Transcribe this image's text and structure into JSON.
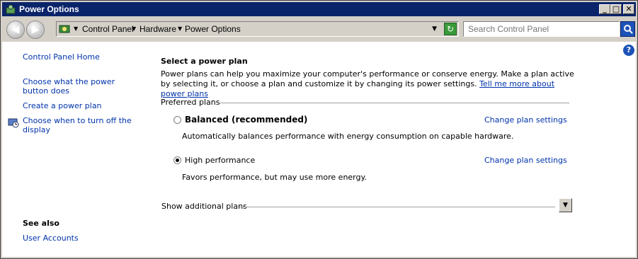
{
  "window": {
    "title": "Power Options"
  },
  "title_buttons": {
    "minimize": "_",
    "maximize": "□",
    "close": "✕"
  },
  "address": {
    "crumbs": [
      "Control Panel",
      "Hardware",
      "Power Options"
    ]
  },
  "search": {
    "placeholder": "Search Control Panel"
  },
  "sidebar": {
    "home": "Control Panel Home",
    "links": [
      {
        "label": "Choose what the power button does"
      },
      {
        "label": "Create a power plan"
      },
      {
        "label": "Choose when to turn off the display"
      }
    ],
    "see_also_title": "See also",
    "see_also_links": [
      {
        "label": "User Accounts"
      }
    ]
  },
  "main": {
    "title": "Select a power plan",
    "intro": "Power plans can help you maximize your computer's performance or conserve energy. Make a plan active by selecting it, or choose a plan and customize it by changing its power settings.",
    "intro_link": "Tell me more about power plans",
    "preferred_label": "Preferred plans",
    "plans": [
      {
        "name": "Balanced (recommended)",
        "description": "Automatically balances performance with energy consumption on capable hardware.",
        "change_link": "Change plan settings",
        "selected": false
      },
      {
        "name": "High performance",
        "description": "Favors performance, but may use more energy.",
        "change_link": "Change plan settings",
        "selected": true
      }
    ],
    "show_additional": "Show additional plans"
  },
  "colors": {
    "titlebar": "#0a246a",
    "link": "#0033aa",
    "face": "#d4d0c8"
  }
}
